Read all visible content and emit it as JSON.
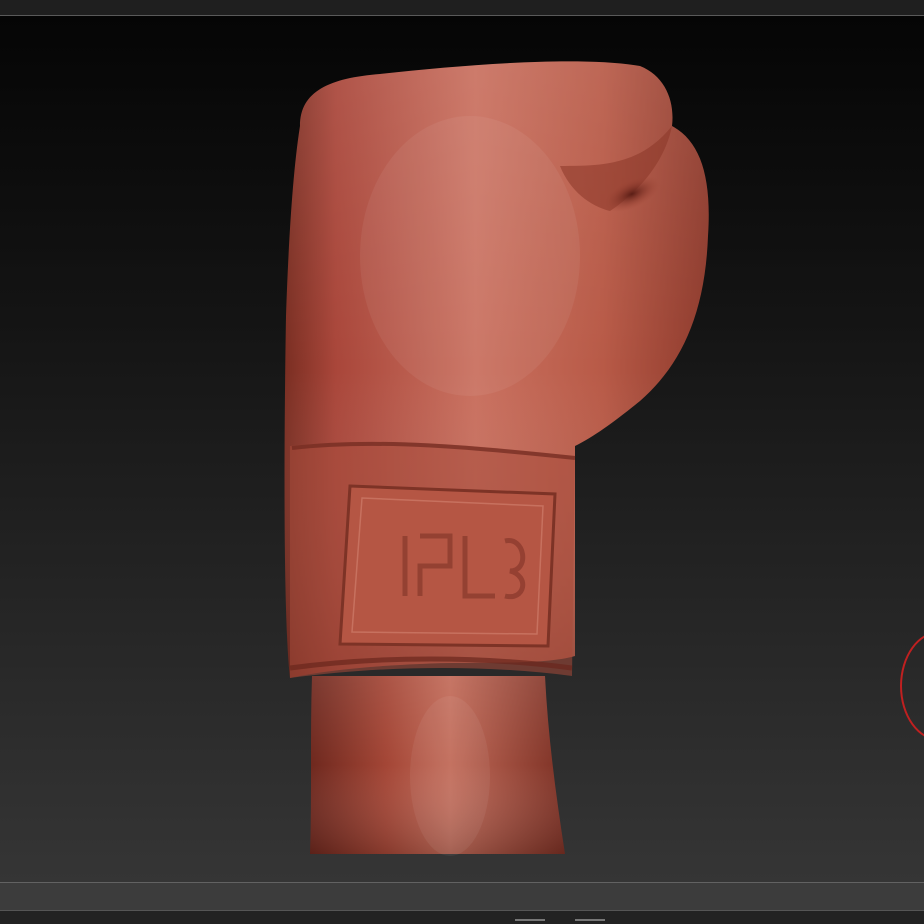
{
  "app": {
    "canvas_background_top": "#050505",
    "canvas_background_bottom": "#353535",
    "model_color": "#b0503c",
    "brush_cursor_color": "#c02020"
  },
  "viewport": {
    "model": "boxing-glove",
    "material": "clay red"
  }
}
